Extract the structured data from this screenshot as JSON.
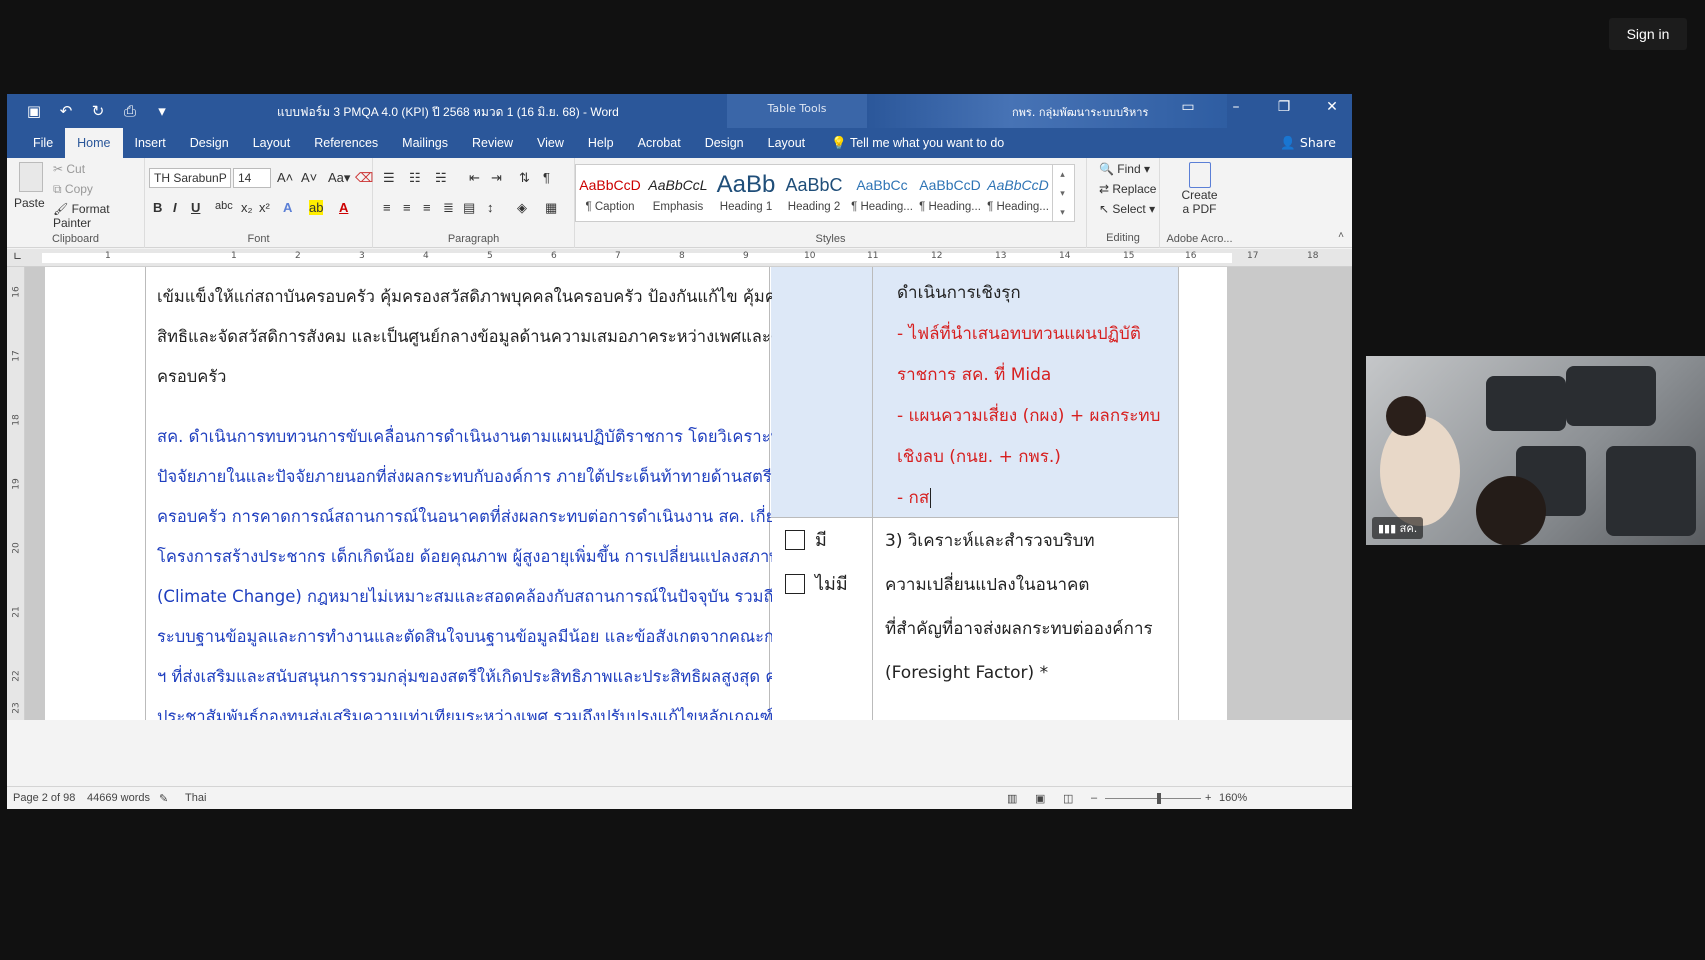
{
  "meeting": {
    "sign_in": "Sign in",
    "participant_name": "สค."
  },
  "window": {
    "title": "แบบฟอร์ม 3 PMQA 4.0 (KPI) ปี 2568 หมวด 1 (16 มิ.ย. 68)  -  Word",
    "table_tools": "Table Tools",
    "account": "กพร. กลุ่มพัฒนาระบบบริหาร"
  },
  "tabs": [
    "File",
    "Home",
    "Insert",
    "Design",
    "Layout",
    "References",
    "Mailings",
    "Review",
    "View",
    "Help",
    "Acrobat",
    "Design",
    "Layout"
  ],
  "tell_me": "Tell me what you want to do",
  "share": "Share",
  "ribbon": {
    "clipboard": {
      "paste": "Paste",
      "cut": "Cut",
      "copy": "Copy",
      "format_painter": "Format Painter",
      "label": "Clipboard"
    },
    "font": {
      "name": "TH SarabunP",
      "size": "14",
      "label": "Font"
    },
    "paragraph": {
      "label": "Paragraph"
    },
    "styles": {
      "label": "Styles",
      "items": [
        {
          "preview": "AaBbCcD",
          "name": "¶ Caption"
        },
        {
          "preview": "AaBbCcL",
          "name": "Emphasis"
        },
        {
          "preview": "AaBb",
          "name": "Heading 1"
        },
        {
          "preview": "AaBbC",
          "name": "Heading 2"
        },
        {
          "preview": "AaBbCc",
          "name": "¶ Heading..."
        },
        {
          "preview": "AaBbCcD",
          "name": "¶ Heading..."
        },
        {
          "preview": "AaBbCcD",
          "name": "¶ Heading..."
        }
      ]
    },
    "editing": {
      "find": "Find",
      "replace": "Replace",
      "select": "Select",
      "label": "Editing"
    },
    "adobe": {
      "create_pdf_1": "Create",
      "create_pdf_2": "a PDF",
      "label": "Adobe Acro..."
    }
  },
  "document": {
    "col1_lines_black": [
      "เข้มแข็งให้แก่สถาบันครอบครัว คุ้มครองสวัสดิภาพบุคคลในครอบครัว ป้องกันแก้ไข คุ้มครอง พิทักษ์",
      "สิทธิและจัดสวัสดิการสังคม และเป็นศูนย์กลางข้อมูลด้านความเสมอภาคระหว่างเพศและด้าน",
      "ครอบครัว"
    ],
    "col1_lines_blue": [
      "            สค. ดำเนินการทบทวนการขับเคลื่อนการดำเนินงานตามแผนปฏิบัติราชการ โดยวิเคราะห์",
      "ปัจจัยภายในและปัจจัยภายนอกที่ส่งผลกระทบกับองค์การ ภายใต้ประเด็นท้าทายด้านสตรีและ",
      "ครอบครัว การคาดการณ์สถานการณ์ในอนาคตที่ส่งผลกระทบต่อการดำเนินงาน สค.  เกี่ยวกับวิกฤต",
      "โครงการสร้างประชากร เด็กเกิดน้อย ด้อยคุณภาพ ผู้สูงอายุเพิ่มขึ้น การเปลี่ยนแปลงสภาพภูมิอากาศ",
      "(Climate Change) กฎหมายไม่เหมาะสมและสอดคล้องกับสถานการณ์ในปัจจุบัน รวมถึงการเชื่อมโยง",
      "ระบบฐานข้อมูลและการทำงานและตัดสินใจบนฐานข้อมูลมีน้อย และข้อสังเกตจากคณะกรรมาธิการ",
      "ฯ ที่ส่งเสริมและสนับสนุนการรวมกลุ่มของสตรีให้เกิดประสิทธิภาพและประสิทธิผลสูงสุด ควร",
      "ประชาสัมพันธ์กองทุนส่งเสริมความเท่าเทียมระหว่างเพศ รวมถึงปรับปรุงแก้ไขหลักเกณฑ์และ"
    ],
    "col3_top_black": "ดำเนินการเชิงรุก",
    "col3_red_lines": [
      "- ไฟล์ที่นำเสนอทบทวนแผนปฏิบัติ",
      "   ราชการ สค. ที่ Mida",
      "- แผนความเสี่ยง (กผง) + ผลกระทบ",
      "   เชิงลบ (กนย. + กพร.)",
      "- กส"
    ],
    "check_yes": "มี",
    "check_no": "ไม่มี",
    "col3_item3_lines": [
      "3) วิเคราะห์และสำรวจบริบท",
      "ความเปลี่ยนแปลงในอนาคต",
      "ที่สำคัญที่อาจส่งผลกระทบต่อองค์การ",
      "(Foresight Factor) *"
    ]
  },
  "status": {
    "page": "Page 2 of 98",
    "words": "44669 words",
    "language": "Thai",
    "zoom": "160%"
  },
  "ruler_numbers": [
    "1",
    "1",
    "2",
    "3",
    "4",
    "5",
    "6",
    "7",
    "8",
    "9",
    "10",
    "11",
    "12",
    "13",
    "14",
    "15",
    "16",
    "17",
    "18"
  ],
  "vruler_numbers": [
    "16",
    "17",
    "18",
    "19",
    "20",
    "21",
    "22",
    "23"
  ]
}
